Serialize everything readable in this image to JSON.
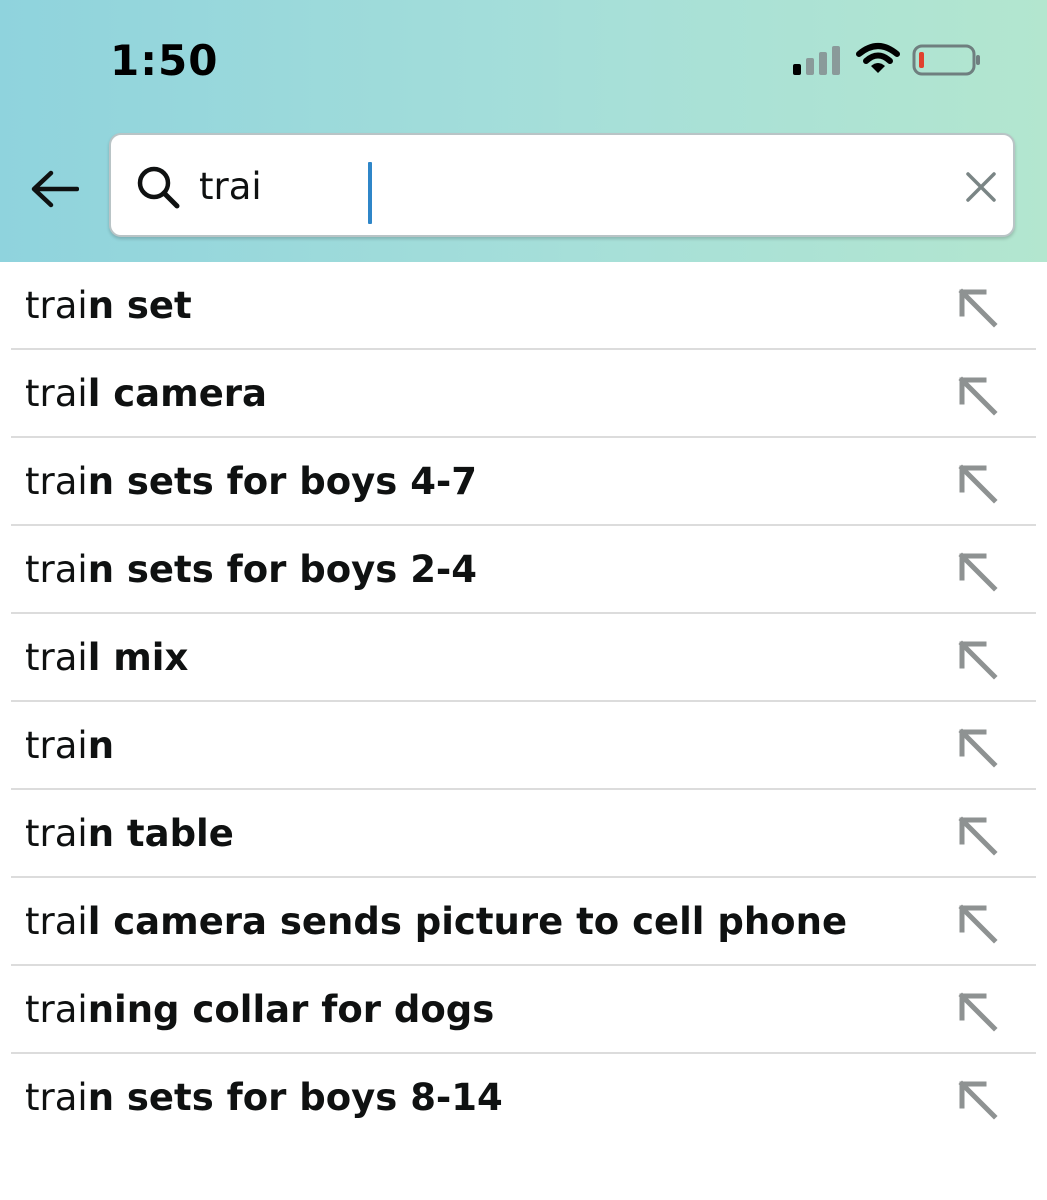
{
  "status_bar": {
    "time": "1:50",
    "signal_icon": "cellular-signal-icon",
    "wifi_icon": "wifi-icon",
    "battery_icon": "battery-low-icon",
    "battery_color": "#e0412f"
  },
  "search": {
    "back_icon": "arrow-left-icon",
    "search_icon": "search-icon",
    "value": "trai",
    "clear_icon": "close-icon",
    "header_gradient": [
      "#8fd3dd",
      "#b3e6cf"
    ]
  },
  "suggestions": [
    {
      "typed": "trai",
      "rest": "n set"
    },
    {
      "typed": "trai",
      "rest": "l camera"
    },
    {
      "typed": "trai",
      "rest": "n sets for boys 4-7"
    },
    {
      "typed": "trai",
      "rest": "n sets for boys 2-4"
    },
    {
      "typed": "trai",
      "rest": "l mix"
    },
    {
      "typed": "trai",
      "rest": "n"
    },
    {
      "typed": "trai",
      "rest": "n table"
    },
    {
      "typed": "trai",
      "rest": "l camera sends picture to cell phone"
    },
    {
      "typed": "trai",
      "rest": "ning collar for dogs"
    },
    {
      "typed": "trai",
      "rest": "n sets for boys 8-14"
    }
  ],
  "suggestion_fill_icon": "arrow-up-left-icon"
}
